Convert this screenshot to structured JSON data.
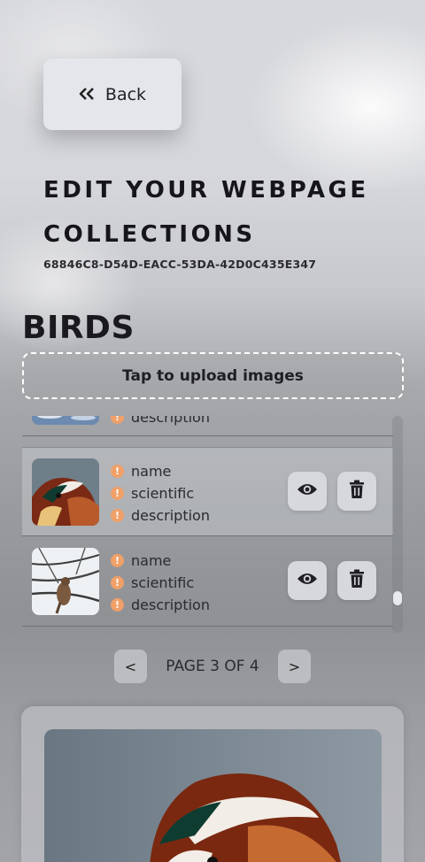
{
  "back_button": {
    "label": "Back",
    "icon": "double-chevron-left-icon"
  },
  "page": {
    "title": "EDIT YOUR WEBPAGE COLLECTIONS",
    "id": "68846C8-D54D-EACC-53DA-42D0C435E347"
  },
  "collection": {
    "title": "BIRDS",
    "upload_label": "Tap to upload images"
  },
  "items": [
    {
      "fields": [
        "description"
      ],
      "thumb": "bird-on-water-photo",
      "partial": true
    },
    {
      "fields": [
        "name",
        "scientific",
        "description"
      ],
      "thumb": "mandarin-duck-photo",
      "selected": true
    },
    {
      "fields": [
        "name",
        "scientific",
        "description"
      ],
      "thumb": "bird-on-branch-photo"
    }
  ],
  "warning_icon": "exclamation-circle-icon",
  "warning_color": "#f0a068",
  "actions": {
    "view_icon": "eye-icon",
    "delete_icon": "trash-icon"
  },
  "pagination": {
    "prev_label": "<",
    "next_label": ">",
    "text": "PAGE 3 OF 4",
    "current": 3,
    "total": 4
  },
  "preview": {
    "image": "mandarin-duck-photo"
  }
}
